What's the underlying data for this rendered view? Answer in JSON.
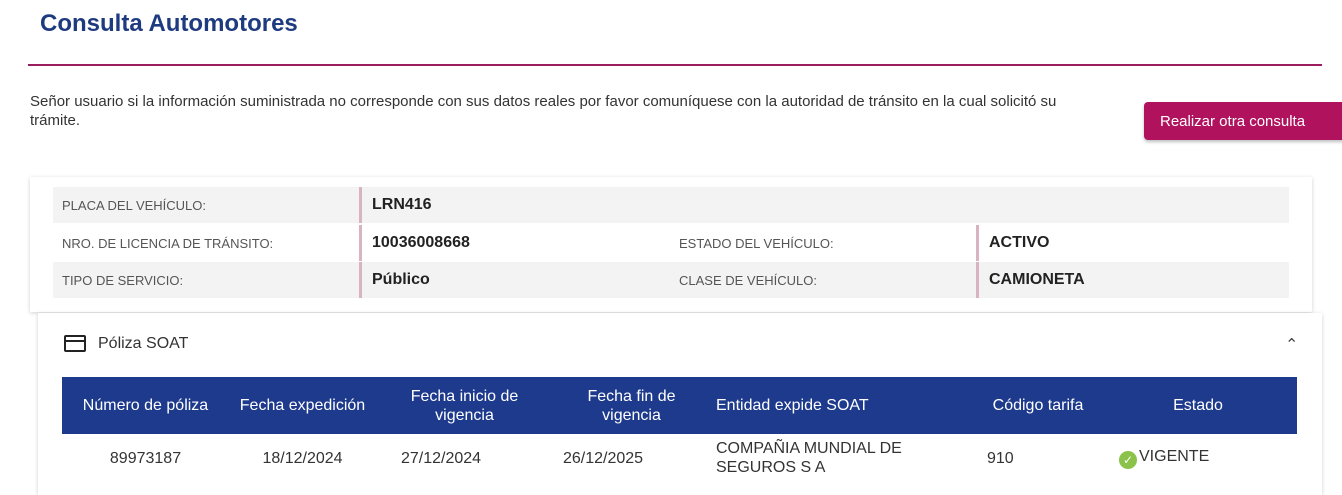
{
  "page": {
    "title": "Consulta Automotores",
    "notice": "Señor usuario si la información suministrada no corresponde con sus datos reales por favor comuníquese con la autoridad de tránsito en la cual solicitó su trámite.",
    "again_button": "Realizar otra consulta"
  },
  "vehicle": {
    "plate_label": "PLACA DEL VEHÍCULO:",
    "plate": "LRN416",
    "license_label": "NRO. DE LICENCIA DE TRÁNSITO:",
    "license": "10036008668",
    "status_label": "ESTADO DEL VEHÍCULO:",
    "status": "ACTIVO",
    "service_label": "TIPO DE SERVICIO:",
    "service": "Público",
    "class_label": "CLASE DE VEHÍCULO:",
    "class": "CAMIONETA"
  },
  "soat": {
    "title": "Póliza SOAT",
    "icon": "credit-card-icon",
    "columns": [
      "Número de póliza",
      "Fecha expedición",
      "Fecha inicio de vigencia",
      "Fecha fin de vigencia",
      "Entidad expide SOAT",
      "Código tarifa",
      "Estado"
    ],
    "rows": [
      {
        "policy": "89973187",
        "issued": "18/12/2024",
        "start": "27/12/2024",
        "end": "26/12/2025",
        "entity": "COMPAÑIA MUNDIAL DE SEGUROS S A",
        "rate_code": "910",
        "status": "VIGENTE"
      }
    ]
  },
  "colors": {
    "title": "#1f3b80",
    "accent": "#b0125e",
    "table_header": "#1d3a8c",
    "ok": "#8bc34a"
  }
}
